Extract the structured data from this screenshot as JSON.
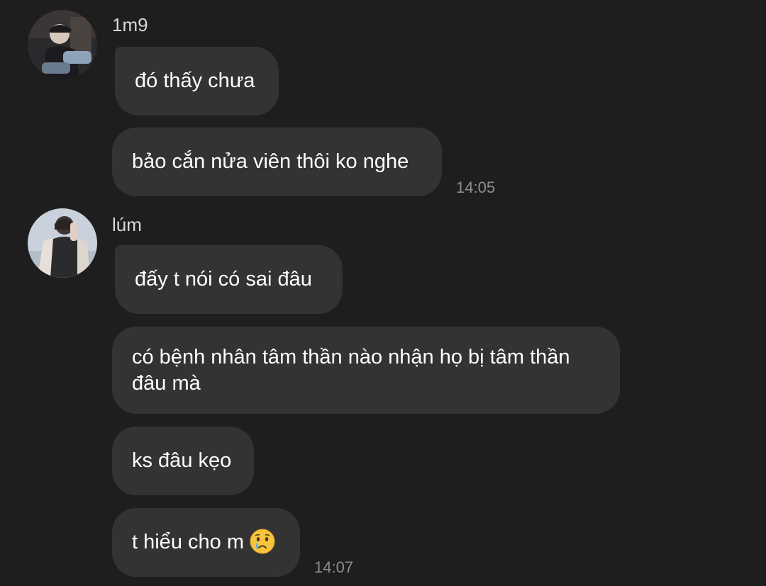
{
  "messages_group_1": {
    "sender": "1m9",
    "messages": [
      "đó thấy chưa",
      "bảo cắn nửa viên thôi ko nghe"
    ],
    "time": "14:05"
  },
  "messages_group_2": {
    "sender": "lúm",
    "messages": [
      "đấy t nói có sai đâu",
      "có bệnh nhân tâm thần nào nhận họ bị tâm thần đâu mà",
      "ks đâu kẹo",
      "t hiểu cho m"
    ],
    "emoji": "crying-face-emoji",
    "time": "14:07"
  },
  "colors": {
    "background": "#1e1e1e",
    "bubble": "#333333",
    "text": "#ffffff",
    "name": "#d8d8d8",
    "time": "#8e8e8e"
  }
}
